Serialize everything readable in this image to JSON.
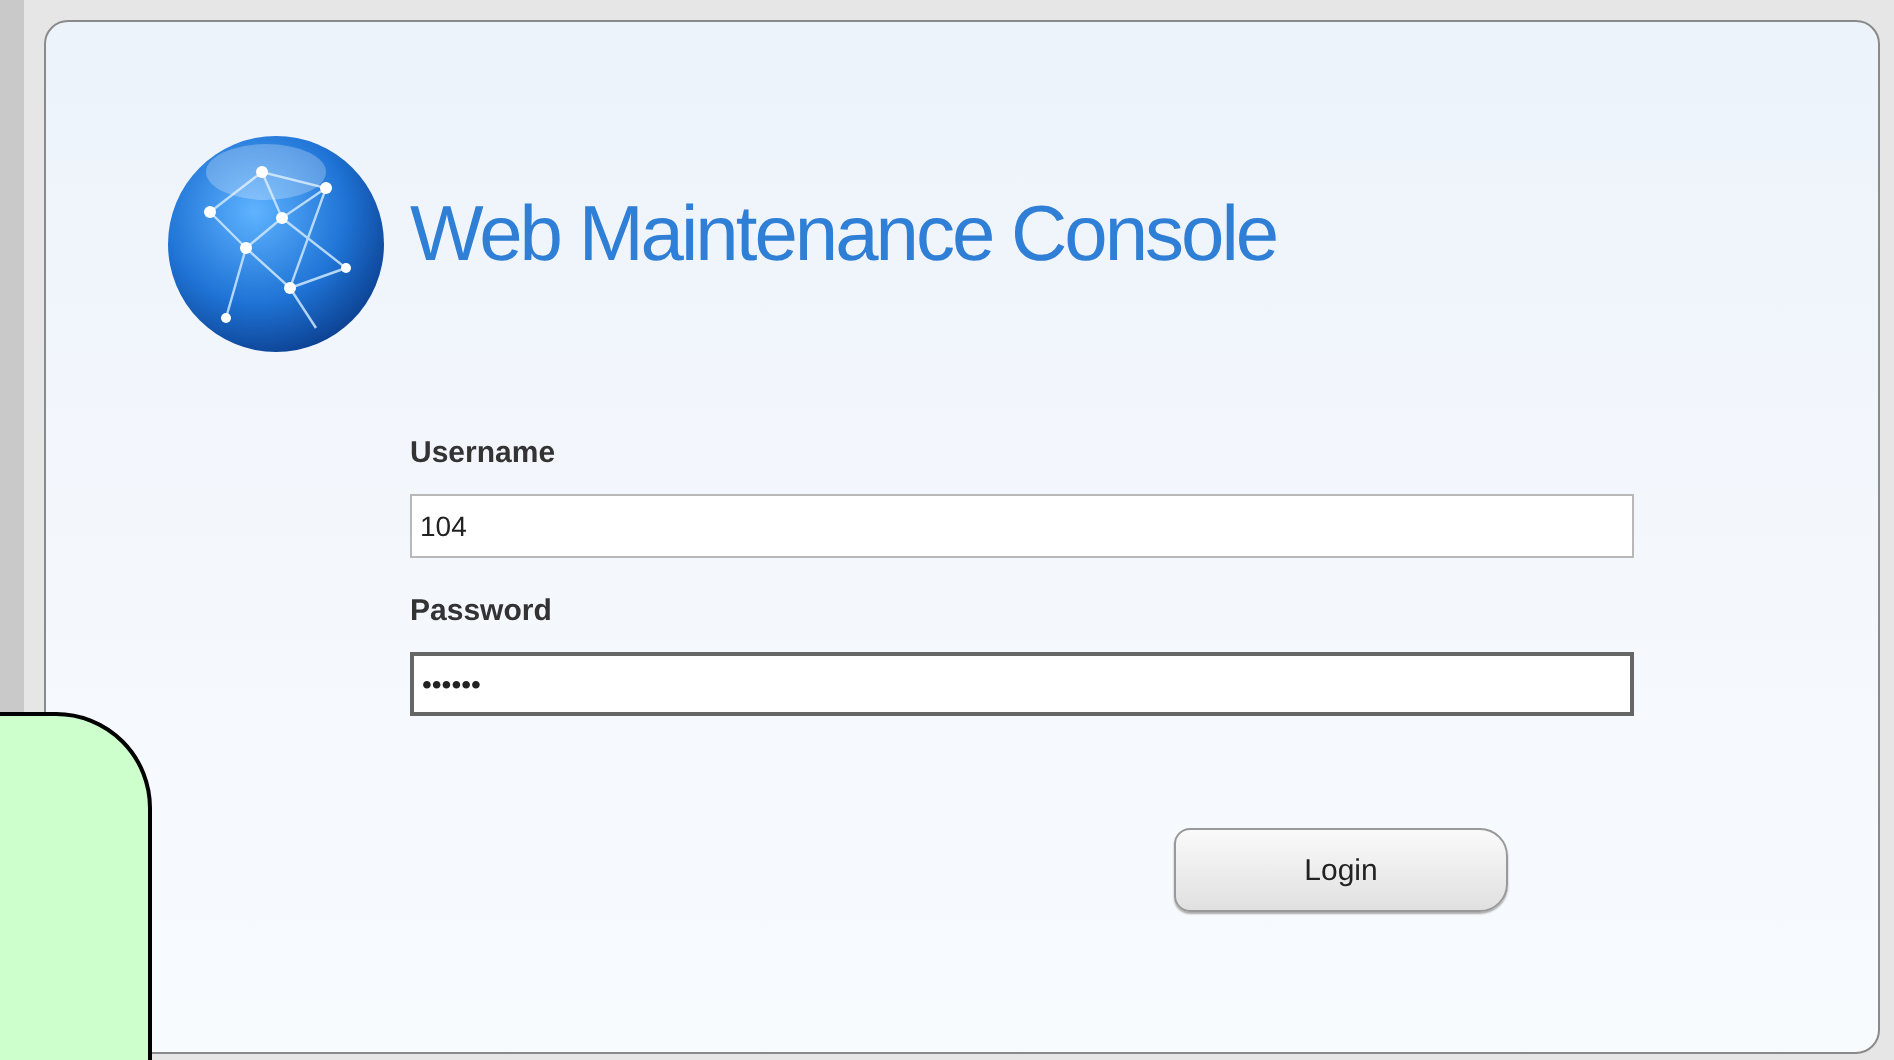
{
  "title": "Web Maintenance Console",
  "form": {
    "fields": [
      {
        "label": "Username",
        "value": "104"
      },
      {
        "label": "Password",
        "value": "••••••"
      }
    ],
    "button": "Login"
  }
}
